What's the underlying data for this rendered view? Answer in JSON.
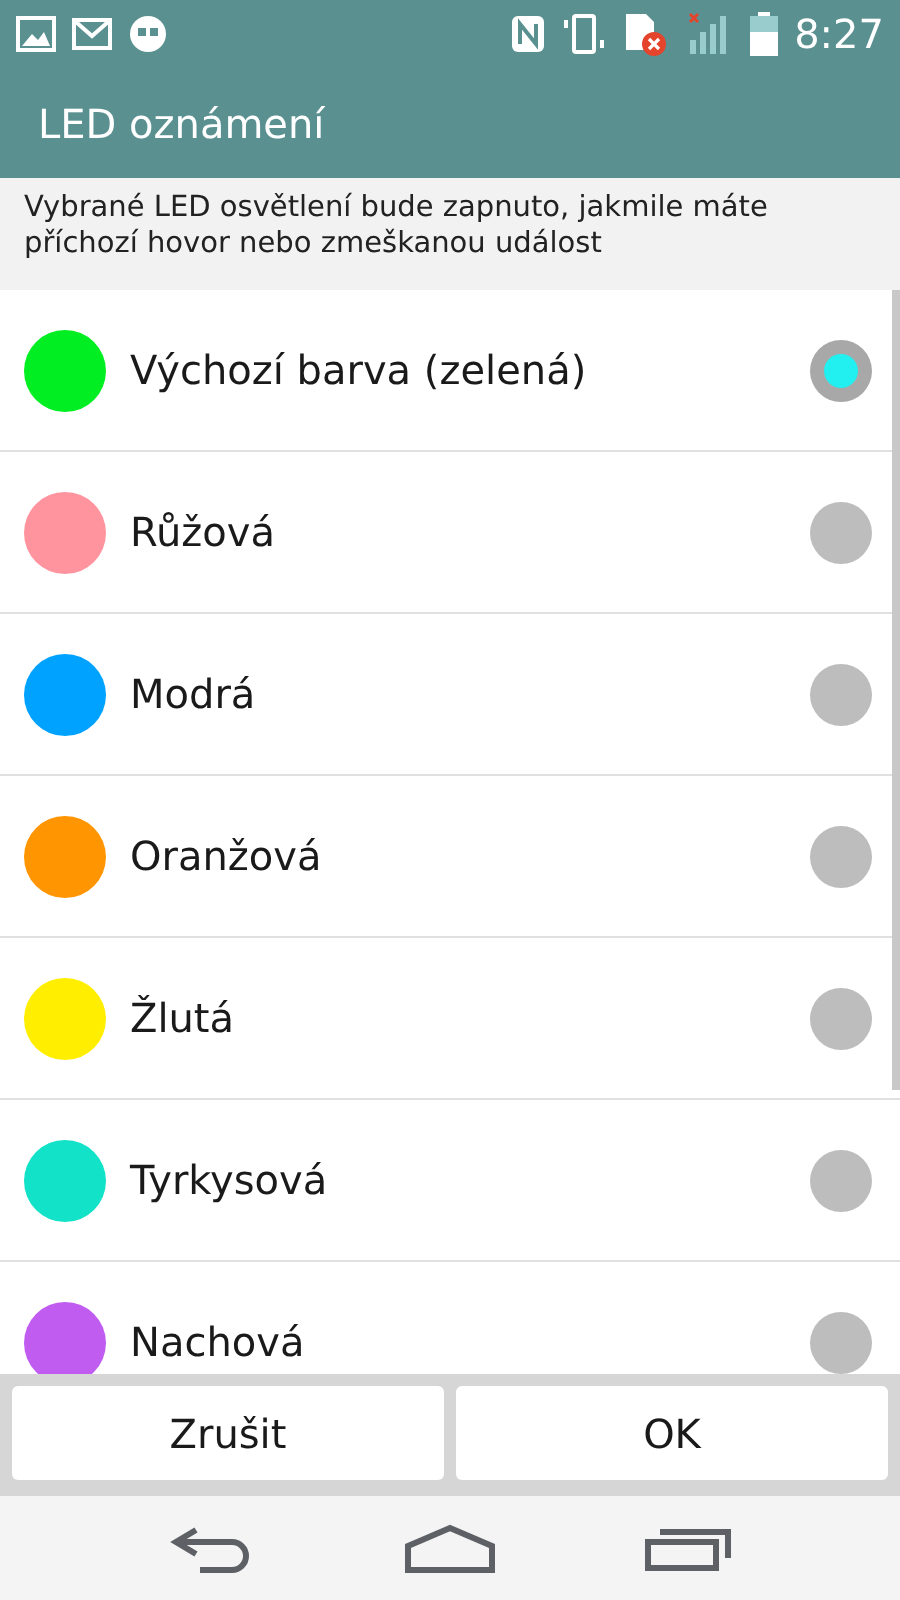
{
  "status_bar": {
    "time": "8:27"
  },
  "title": "LED oznámení",
  "description": "Vybrané LED osvětlení bude zapnuto, jakmile máte příchozí hovor nebo zmeškanou událost",
  "options": [
    {
      "label": "Výchozí barva (zelená)",
      "color": "#00ee22",
      "selected": true
    },
    {
      "label": "Růžová",
      "color": "#ff949e",
      "selected": false
    },
    {
      "label": "Modrá",
      "color": "#00a2ff",
      "selected": false
    },
    {
      "label": "Oranžová",
      "color": "#ff9500",
      "selected": false
    },
    {
      "label": "Žlutá",
      "color": "#ffee00",
      "selected": false
    },
    {
      "label": "Tyrkysová",
      "color": "#11e2c8",
      "selected": false
    },
    {
      "label": "Nachová",
      "color": "#c05cf0",
      "selected": false
    }
  ],
  "buttons": [
    "Zrušit",
    "OK"
  ]
}
